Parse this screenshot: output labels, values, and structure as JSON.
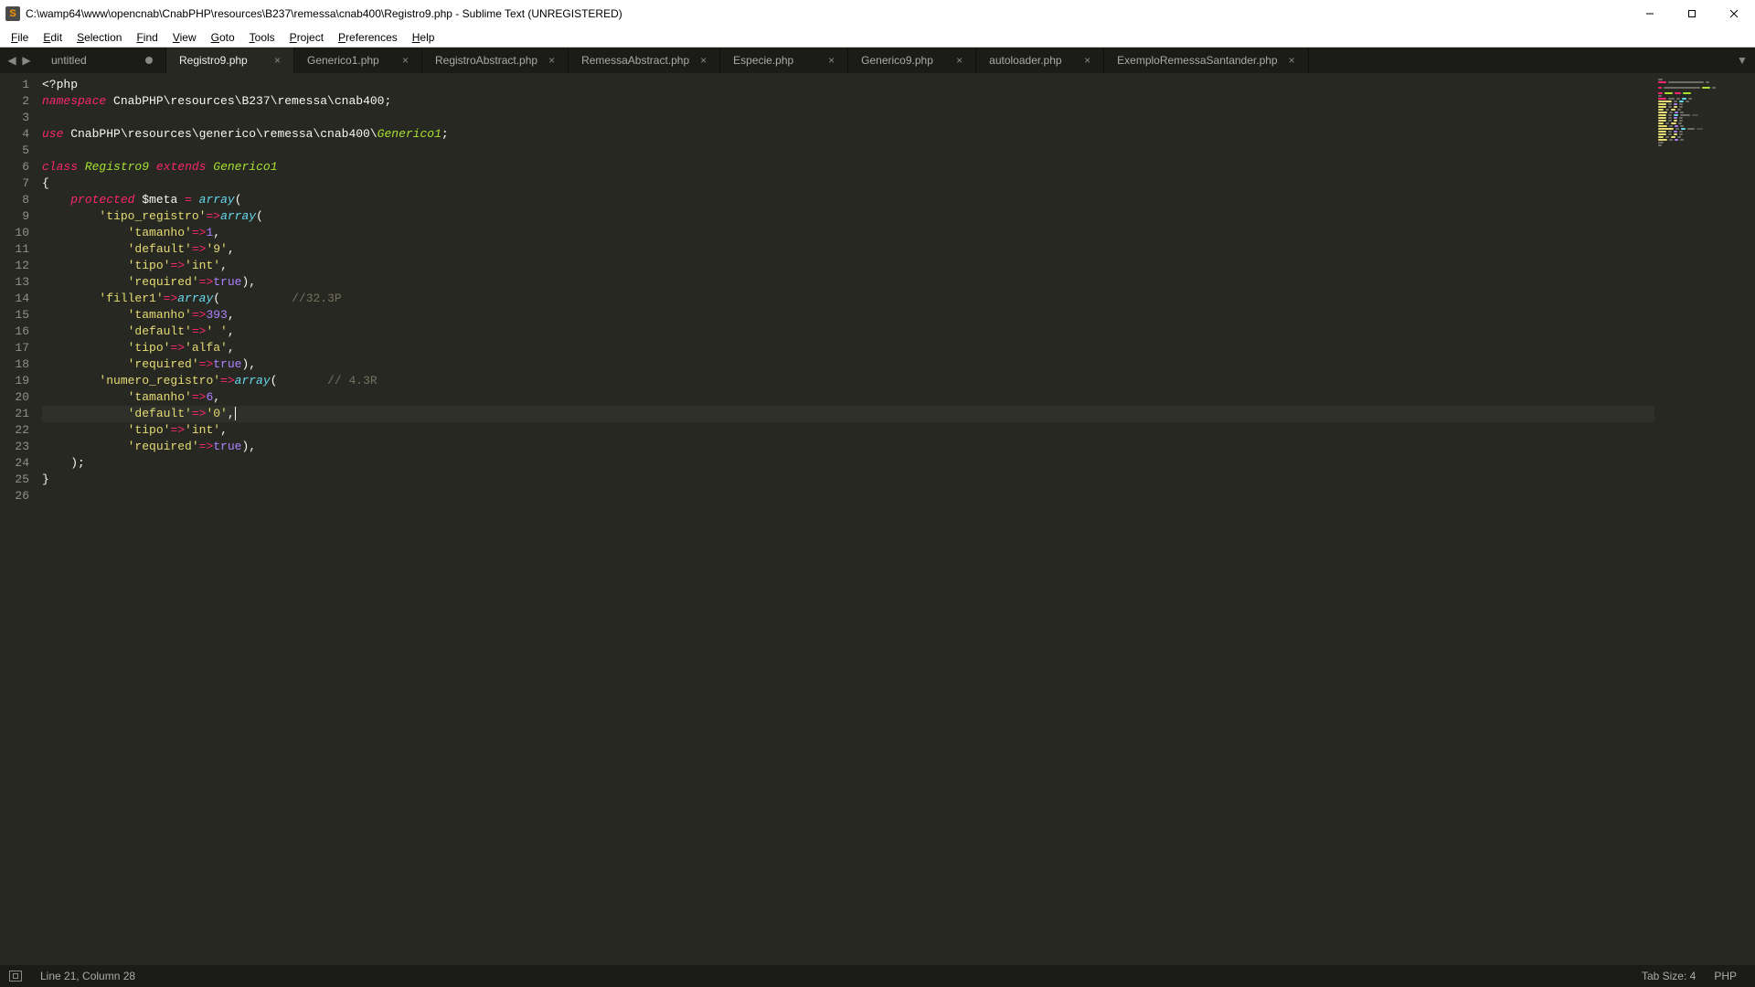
{
  "window": {
    "title": "C:\\wamp64\\www\\opencnab\\CnabPHP\\resources\\B237\\remessa\\cnab400\\Registro9.php - Sublime Text (UNREGISTERED)"
  },
  "menu": {
    "items": [
      "File",
      "Edit",
      "Selection",
      "Find",
      "View",
      "Goto",
      "Tools",
      "Project",
      "Preferences",
      "Help"
    ]
  },
  "tabs": [
    {
      "label": "untitled",
      "dirty": true,
      "active": false
    },
    {
      "label": "Registro9.php",
      "dirty": false,
      "active": true
    },
    {
      "label": "Generico1.php",
      "dirty": false,
      "active": false
    },
    {
      "label": "RegistroAbstract.php",
      "dirty": false,
      "active": false
    },
    {
      "label": "RemessaAbstract.php",
      "dirty": false,
      "active": false
    },
    {
      "label": "Especie.php",
      "dirty": false,
      "active": false
    },
    {
      "label": "Generico9.php",
      "dirty": false,
      "active": false
    },
    {
      "label": "autoloader.php",
      "dirty": false,
      "active": false
    },
    {
      "label": "ExemploRemessaSantander.php",
      "dirty": false,
      "active": false
    }
  ],
  "editor": {
    "cursor_line": 21,
    "lines": [
      [
        {
          "t": "<?php",
          "c": "tok-punc"
        }
      ],
      [
        {
          "t": "namespace",
          "c": "tok-kw"
        },
        {
          "t": " CnabPHP\\resources\\B237\\remessa\\cnab400",
          "c": "tok-var"
        },
        {
          "t": ";",
          "c": "tok-punc"
        }
      ],
      [],
      [
        {
          "t": "use",
          "c": "tok-kw"
        },
        {
          "t": " CnabPHP\\resources\\generico\\remessa\\cnab400\\",
          "c": "tok-var"
        },
        {
          "t": "Generico1",
          "c": "tok-type"
        },
        {
          "t": ";",
          "c": "tok-punc"
        }
      ],
      [],
      [
        {
          "t": "class",
          "c": "tok-kw"
        },
        {
          "t": " ",
          "c": ""
        },
        {
          "t": "Registro9",
          "c": "tok-type"
        },
        {
          "t": " ",
          "c": ""
        },
        {
          "t": "extends",
          "c": "tok-kw"
        },
        {
          "t": " ",
          "c": ""
        },
        {
          "t": "Generico1",
          "c": "tok-type"
        }
      ],
      [
        {
          "t": "{",
          "c": "tok-punc"
        }
      ],
      [
        {
          "t": "    ",
          "c": ""
        },
        {
          "t": "protected",
          "c": "tok-kw"
        },
        {
          "t": " $meta ",
          "c": "tok-var"
        },
        {
          "t": "=",
          "c": "tok-op"
        },
        {
          "t": " ",
          "c": ""
        },
        {
          "t": "array",
          "c": "tok-func"
        },
        {
          "t": "(",
          "c": "tok-punc"
        }
      ],
      [
        {
          "t": "        ",
          "c": ""
        },
        {
          "t": "'tipo_registro'",
          "c": "tok-str"
        },
        {
          "t": "=>",
          "c": "tok-op"
        },
        {
          "t": "array",
          "c": "tok-func"
        },
        {
          "t": "(",
          "c": "tok-punc"
        }
      ],
      [
        {
          "t": "            ",
          "c": ""
        },
        {
          "t": "'tamanho'",
          "c": "tok-str"
        },
        {
          "t": "=>",
          "c": "tok-op"
        },
        {
          "t": "1",
          "c": "tok-num"
        },
        {
          "t": ",",
          "c": "tok-punc"
        }
      ],
      [
        {
          "t": "            ",
          "c": ""
        },
        {
          "t": "'default'",
          "c": "tok-str"
        },
        {
          "t": "=>",
          "c": "tok-op"
        },
        {
          "t": "'9'",
          "c": "tok-str"
        },
        {
          "t": ",",
          "c": "tok-punc"
        }
      ],
      [
        {
          "t": "            ",
          "c": ""
        },
        {
          "t": "'tipo'",
          "c": "tok-str"
        },
        {
          "t": "=>",
          "c": "tok-op"
        },
        {
          "t": "'int'",
          "c": "tok-str"
        },
        {
          "t": ",",
          "c": "tok-punc"
        }
      ],
      [
        {
          "t": "            ",
          "c": ""
        },
        {
          "t": "'required'",
          "c": "tok-str"
        },
        {
          "t": "=>",
          "c": "tok-op"
        },
        {
          "t": "true",
          "c": "tok-num"
        },
        {
          "t": "),",
          "c": "tok-punc"
        }
      ],
      [
        {
          "t": "        ",
          "c": ""
        },
        {
          "t": "'filler1'",
          "c": "tok-str"
        },
        {
          "t": "=>",
          "c": "tok-op"
        },
        {
          "t": "array",
          "c": "tok-func"
        },
        {
          "t": "(          ",
          "c": "tok-punc"
        },
        {
          "t": "//32.3P",
          "c": "tok-com"
        }
      ],
      [
        {
          "t": "            ",
          "c": ""
        },
        {
          "t": "'tamanho'",
          "c": "tok-str"
        },
        {
          "t": "=>",
          "c": "tok-op"
        },
        {
          "t": "393",
          "c": "tok-num"
        },
        {
          "t": ",",
          "c": "tok-punc"
        }
      ],
      [
        {
          "t": "            ",
          "c": ""
        },
        {
          "t": "'default'",
          "c": "tok-str"
        },
        {
          "t": "=>",
          "c": "tok-op"
        },
        {
          "t": "' '",
          "c": "tok-str"
        },
        {
          "t": ",",
          "c": "tok-punc"
        }
      ],
      [
        {
          "t": "            ",
          "c": ""
        },
        {
          "t": "'tipo'",
          "c": "tok-str"
        },
        {
          "t": "=>",
          "c": "tok-op"
        },
        {
          "t": "'alfa'",
          "c": "tok-str"
        },
        {
          "t": ",",
          "c": "tok-punc"
        }
      ],
      [
        {
          "t": "            ",
          "c": ""
        },
        {
          "t": "'required'",
          "c": "tok-str"
        },
        {
          "t": "=>",
          "c": "tok-op"
        },
        {
          "t": "true",
          "c": "tok-num"
        },
        {
          "t": "),",
          "c": "tok-punc"
        }
      ],
      [
        {
          "t": "        ",
          "c": ""
        },
        {
          "t": "'numero_registro'",
          "c": "tok-str"
        },
        {
          "t": "=>",
          "c": "tok-op"
        },
        {
          "t": "array",
          "c": "tok-func"
        },
        {
          "t": "(       ",
          "c": "tok-punc"
        },
        {
          "t": "// 4.3R",
          "c": "tok-com"
        }
      ],
      [
        {
          "t": "            ",
          "c": ""
        },
        {
          "t": "'tamanho'",
          "c": "tok-str"
        },
        {
          "t": "=>",
          "c": "tok-op"
        },
        {
          "t": "6",
          "c": "tok-num"
        },
        {
          "t": ",",
          "c": "tok-punc"
        }
      ],
      [
        {
          "t": "            ",
          "c": ""
        },
        {
          "t": "'default'",
          "c": "tok-str"
        },
        {
          "t": "=>",
          "c": "tok-op"
        },
        {
          "t": "'0'",
          "c": "tok-str"
        },
        {
          "t": ",",
          "c": "tok-punc"
        }
      ],
      [
        {
          "t": "            ",
          "c": ""
        },
        {
          "t": "'tipo'",
          "c": "tok-str"
        },
        {
          "t": "=>",
          "c": "tok-op"
        },
        {
          "t": "'int'",
          "c": "tok-str"
        },
        {
          "t": ",",
          "c": "tok-punc"
        }
      ],
      [
        {
          "t": "            ",
          "c": ""
        },
        {
          "t": "'required'",
          "c": "tok-str"
        },
        {
          "t": "=>",
          "c": "tok-op"
        },
        {
          "t": "true",
          "c": "tok-num"
        },
        {
          "t": "),",
          "c": "tok-punc"
        }
      ],
      [
        {
          "t": "    );",
          "c": "tok-punc"
        }
      ],
      [
        {
          "t": "}",
          "c": "tok-punc"
        }
      ],
      []
    ]
  },
  "status": {
    "position": "Line 21, Column 28",
    "indent": "Tab Size: 4",
    "syntax": "PHP"
  }
}
